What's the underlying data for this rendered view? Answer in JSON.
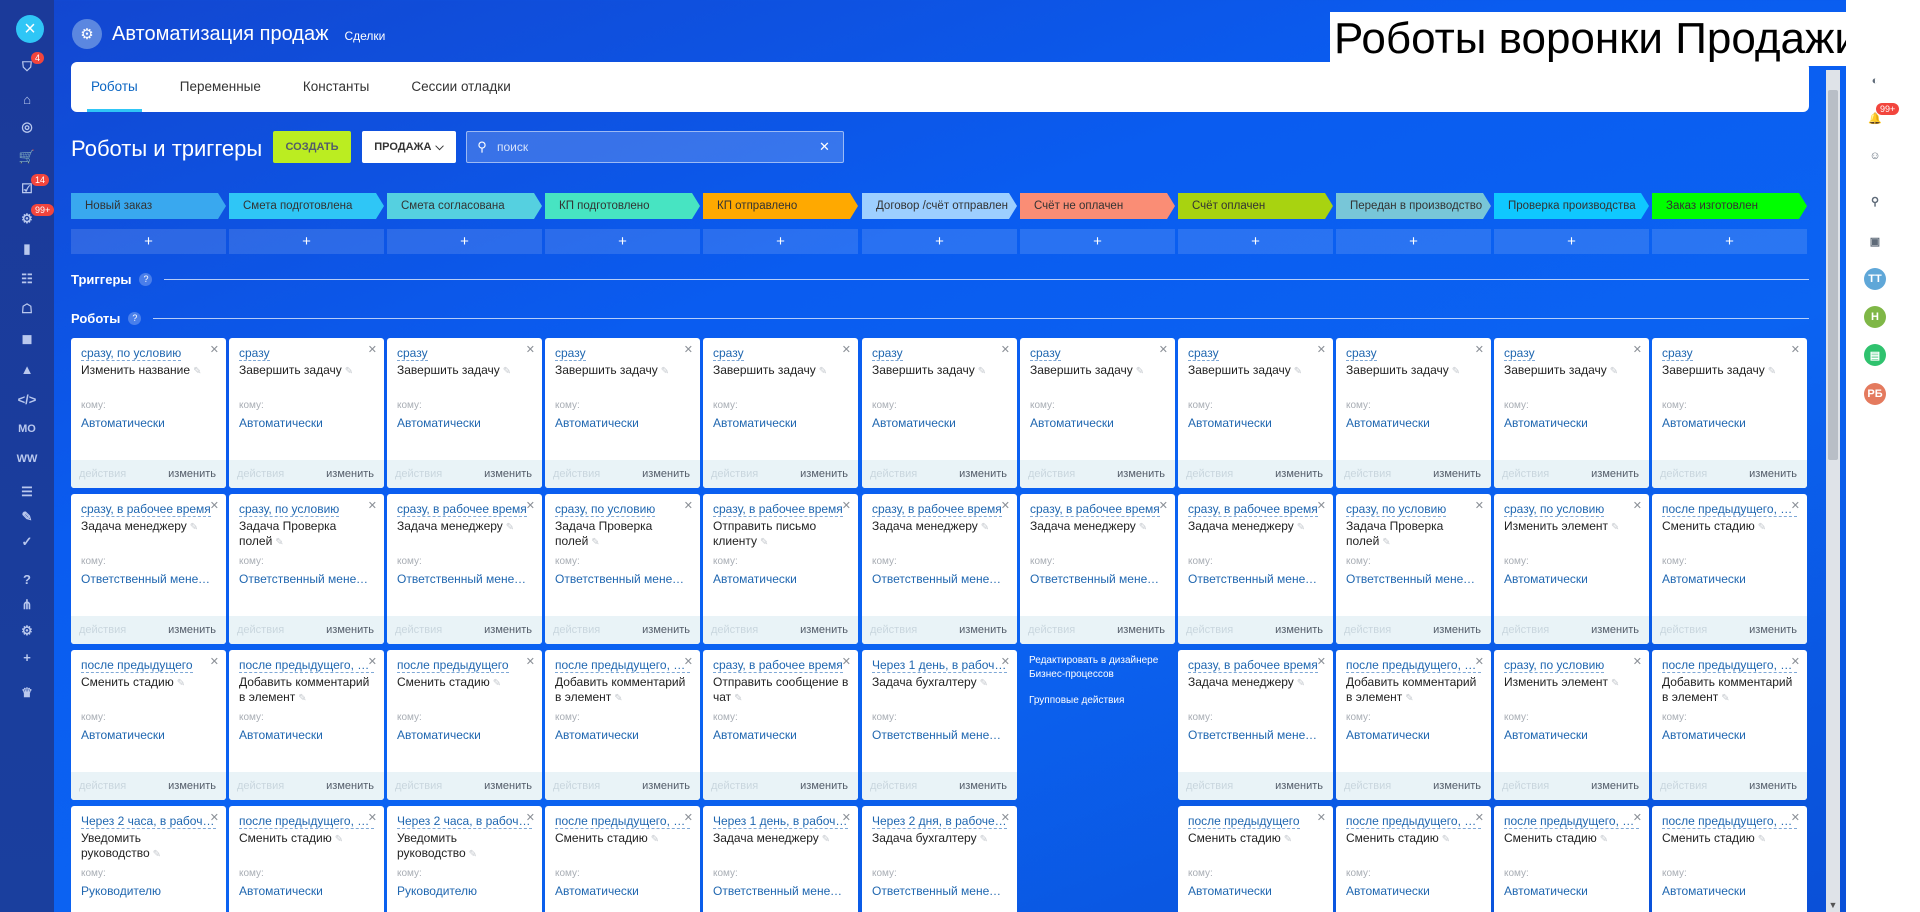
{
  "app": {
    "title": "Автоматизация продаж",
    "subtitle": "Сделки"
  },
  "overlay_title": "Роботы воронки Продажи",
  "tabs": [
    "Роботы",
    "Переменные",
    "Константы",
    "Сессии отладки"
  ],
  "section_title": "Роботы и триггеры",
  "create_label": "СОЗДАТЬ",
  "funnel_label": "ПРОДАЖА",
  "search_placeholder": "поиск",
  "triggers_label": "Триггеры",
  "robots_label": "Роботы",
  "stages": [
    {
      "name": "Новый заказ",
      "color": "#39a8ef"
    },
    {
      "name": "Смета подготовлена",
      "color": "#2fc6f6"
    },
    {
      "name": "Смета согласована",
      "color": "#55d0e0"
    },
    {
      "name": "КП подготовлено",
      "color": "#47e4c2"
    },
    {
      "name": "КП отправлено",
      "color": "#ffa900"
    },
    {
      "name": "Договор /счёт отправлен",
      "color": "#9dcfff"
    },
    {
      "name": "Счёт не оплачен",
      "color": "#fa8d75"
    },
    {
      "name": "Счёт оплачен",
      "color": "#a8d310"
    },
    {
      "name": "Передан в производство",
      "color": "#78c6d8"
    },
    {
      "name": "Проверка производства",
      "color": "#0fc8ff"
    },
    {
      "name": "Заказ изготовлен",
      "color": "#00ff00"
    }
  ],
  "labels": {
    "to": "кому:",
    "actions": "действия",
    "edit": "изменить"
  },
  "bp_links": {
    "designer": "Редактировать в дизайнере Бизнес-процессов",
    "group": "Групповые действия"
  },
  "rows": [
    [
      {
        "cond": "сразу, по условию",
        "title": "Изменить название",
        "resp": "Автоматически"
      },
      {
        "cond": "сразу",
        "title": "Завершить задачу",
        "resp": "Автоматически"
      },
      {
        "cond": "сразу",
        "title": "Завершить задачу",
        "resp": "Автоматически"
      },
      {
        "cond": "сразу",
        "title": "Завершить задачу",
        "resp": "Автоматически"
      },
      {
        "cond": "сразу",
        "title": "Завершить задачу",
        "resp": "Автоматически"
      },
      {
        "cond": "сразу",
        "title": "Завершить задачу",
        "resp": "Автоматически"
      },
      {
        "cond": "сразу",
        "title": "Завершить задачу",
        "resp": "Автоматически"
      },
      {
        "cond": "сразу",
        "title": "Завершить задачу",
        "resp": "Автоматически"
      },
      {
        "cond": "сразу",
        "title": "Завершить задачу",
        "resp": "Автоматически"
      },
      {
        "cond": "сразу",
        "title": "Завершить задачу",
        "resp": "Автоматически"
      },
      {
        "cond": "сразу",
        "title": "Завершить задачу",
        "resp": "Автоматически"
      }
    ],
    [
      {
        "cond": "сразу, в рабочее время",
        "title": "Задача менеджеру",
        "resp": "Ответственный менеджер"
      },
      {
        "cond": "сразу, по условию",
        "title": "Задача Проверка полей",
        "resp": "Ответственный менеджер"
      },
      {
        "cond": "сразу, в рабочее время",
        "title": "Задача менеджеру",
        "resp": "Ответственный менеджер"
      },
      {
        "cond": "сразу, по условию",
        "title": "Задача Проверка полей",
        "resp": "Ответственный менеджер"
      },
      {
        "cond": "сразу, в рабочее время",
        "title": "Отправить письмо клиенту",
        "resp": "Автоматически"
      },
      {
        "cond": "сразу, в рабочее время",
        "title": "Задача менеджеру",
        "resp": "Ответственный менеджер"
      },
      {
        "cond": "сразу, в рабочее время",
        "title": "Задача менеджеру",
        "resp": "Ответственный менеджер"
      },
      {
        "cond": "сразу, в рабочее время",
        "title": "Задача менеджеру",
        "resp": "Ответственный менеджер"
      },
      {
        "cond": "сразу, по условию",
        "title": "Задача Проверка полей",
        "resp": "Ответственный менеджер"
      },
      {
        "cond": "сразу, по условию",
        "title": "Изменить элемент",
        "resp": "Автоматически"
      },
      {
        "cond": "после предыдущего, по условию",
        "title": "Сменить стадию",
        "resp": "Автоматически"
      }
    ],
    [
      {
        "cond": "после предыдущего",
        "title": "Сменить стадию",
        "resp": "Автоматически"
      },
      {
        "cond": "после предыдущего, по условию",
        "title": "Добавить комментарий в элемент",
        "resp": "Автоматически"
      },
      {
        "cond": "после предыдущего",
        "title": "Сменить стадию",
        "resp": "Автоматически"
      },
      {
        "cond": "после предыдущего, по условию",
        "title": "Добавить комментарий в элемент",
        "resp": "Автоматически"
      },
      {
        "cond": "сразу, в рабочее время",
        "title": "Отправить сообщение в чат",
        "resp": "Автоматически"
      },
      {
        "cond": "Через 1 день, в рабочее время",
        "title": "Задача бухгалтеру",
        "resp": "Ответственный менеджер"
      },
      null,
      {
        "cond": "сразу, в рабочее время",
        "title": "Задача менеджеру",
        "resp": "Ответственный менеджер"
      },
      {
        "cond": "после предыдущего, по условию",
        "title": "Добавить комментарий в элемент",
        "resp": "Автоматически"
      },
      {
        "cond": "сразу, по условию",
        "title": "Изменить элемент",
        "resp": "Автоматически"
      },
      {
        "cond": "после предыдущего, по условию",
        "title": "Добавить комментарий в элемент",
        "resp": "Автоматически"
      }
    ],
    [
      {
        "cond": "Через 2 часа, в рабочее время",
        "title": "Уведомить руководство",
        "resp": "Руководителю"
      },
      {
        "cond": "после предыдущего, по условию",
        "title": "Сменить стадию",
        "resp": "Автоматически"
      },
      {
        "cond": "Через 2 часа, в рабочее время",
        "title": "Уведомить руководство",
        "resp": "Руководителю"
      },
      {
        "cond": "после предыдущего, по условию",
        "title": "Сменить стадию",
        "resp": "Автоматически"
      },
      {
        "cond": "Через 1 день, в рабочее время",
        "title": "Задача менеджеру",
        "resp": "Ответственный менеджер"
      },
      {
        "cond": "Через 2 дня, в рабочее время",
        "title": "Задача бухгалтеру",
        "resp": "Ответственный менеджер"
      },
      null,
      {
        "cond": "после предыдущего",
        "title": "Сменить стадию",
        "resp": "Автоматически"
      },
      {
        "cond": "после предыдущего, по условию",
        "title": "Сменить стадию",
        "resp": "Автоматически"
      },
      {
        "cond": "после предыдущего, по условию",
        "title": "Сменить стадию",
        "resp": "Автоматически"
      },
      {
        "cond": "после предыдущего, по условию",
        "title": "Сменить стадию",
        "resp": "Автоматически"
      }
    ]
  ],
  "left_nav": [
    {
      "icon": "filter-icon",
      "badge": "4"
    },
    {
      "icon": "bank-icon"
    },
    {
      "icon": "target-icon"
    },
    {
      "icon": "cart-icon"
    },
    {
      "icon": "tasks-icon",
      "badge": "14"
    },
    {
      "icon": "crm-icon",
      "badge": "99+"
    },
    {
      "icon": "analytics-icon"
    },
    {
      "icon": "contact-icon"
    },
    {
      "icon": "robot-icon"
    },
    {
      "icon": "box-icon"
    },
    {
      "icon": "market-icon"
    },
    {
      "icon": "code-icon"
    },
    {
      "icon": "mo-icon",
      "text": "MO"
    },
    {
      "icon": "ww-icon",
      "text": "WW"
    },
    {
      "icon": "document-icon"
    },
    {
      "icon": "sign-icon"
    },
    {
      "icon": "check-icon"
    },
    {
      "icon": "help-icon"
    },
    {
      "icon": "sitemap-icon"
    },
    {
      "icon": "settings-icon"
    },
    {
      "icon": "add-icon"
    },
    {
      "icon": "crown-icon"
    }
  ],
  "right_nav": [
    {
      "icon": "copilot-icon"
    },
    {
      "icon": "bell-icon",
      "badge": "99+"
    },
    {
      "icon": "chat-icon"
    },
    {
      "icon": "search-icon"
    },
    {
      "icon": "open-lines-icon"
    },
    {
      "icon": "avatar-tt",
      "text": "ТТ",
      "color": "#5fa7d8"
    },
    {
      "icon": "avatar-n",
      "text": "Н",
      "color": "#7fb747"
    },
    {
      "icon": "green-app-icon",
      "color": "#2fc26e"
    },
    {
      "icon": "avatar-rb",
      "text": "РБ",
      "color": "#e47a5e"
    }
  ]
}
